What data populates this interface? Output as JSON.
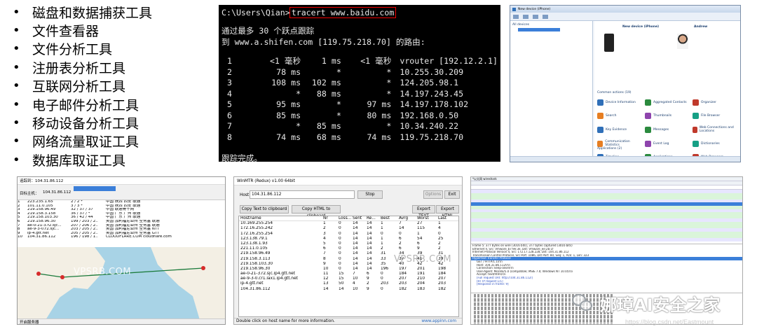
{
  "bullets": [
    "磁盘和数据捕获工具",
    "文件查看器",
    "文件分析工具",
    "注册表分析工具",
    "互联网分析工具",
    "电子邮件分析工具",
    "移动设备分析工具",
    "网络流量取证工具",
    "数据库取证工具"
  ],
  "bullet_glyph": "•",
  "cmd": {
    "prompt": "C:\\Users\\Qian>",
    "command": "tracert www.baidu.com",
    "line1": "通过最多 30 个跃点跟踪",
    "line2": "到 www.a.shifen.com [119.75.218.70] 的路由:",
    "hops": [
      [
        "1",
        "<1 毫秒",
        "1 ms",
        "<1 毫秒",
        "vrouter [192.12.2.1]"
      ],
      [
        "2",
        "78 ms",
        "*",
        "*",
        "10.255.30.209"
      ],
      [
        "3",
        "108 ms",
        "102 ms",
        "*",
        "124.205.98.1"
      ],
      [
        "4",
        "*",
        "88 ms",
        "*",
        "14.197.243.45"
      ],
      [
        "5",
        "95 ms",
        "*",
        "97 ms",
        "14.197.178.102"
      ],
      [
        "6",
        "85 ms",
        "*",
        "80 ms",
        "192.168.0.50"
      ],
      [
        "7",
        "*",
        "85 ms",
        "*",
        "10.34.240.22"
      ],
      [
        "8",
        "74 ms",
        "68 ms",
        "74 ms",
        "119.75.218.70"
      ]
    ],
    "footer": "跟踪完成。"
  },
  "device_explorer": {
    "title": "New device (iPhone)",
    "person": "Andrew",
    "tree_root": "All devices",
    "sections": [
      "Common actions (19)",
      "Applications (2)"
    ],
    "actions": [
      "Device Information",
      "Aggregated Contacts",
      "Organizer",
      "Search",
      "Thumbnails",
      "File Browser",
      "Key Evidence",
      "Messages",
      "Web Connections and Locations",
      "Communication Statistics",
      "Event Log",
      "Dictionaries",
      "Timeline",
      "Applications",
      "Web Browsers"
    ],
    "icon_colors": [
      "#2f6fb8",
      "#2b8a3e",
      "#c0392b",
      "#e67e22",
      "#8e44ad",
      "#16a085"
    ]
  },
  "besttrace": {
    "title": "追踪到：104.31.86.112",
    "host_label": "目标主机：",
    "host": "104.31.86.112",
    "rows": [
      [
        "1",
        "223.235.1.65",
        "2 / 2 *",
        "中国 陕西 西安 联通"
      ],
      [
        "2",
        "101.11.0.105",
        "3 / 3 *",
        "中国 陕西 西安 联通"
      ],
      [
        "3",
        "219.158.96.49",
        "32 / 37 / 37",
        "中国 联通骨干网"
      ],
      [
        "4",
        "219.158.3.158",
        "36 / 37 / *",
        "中国 广东 广州 联通"
      ],
      [
        "5",
        "219.158.103.30",
        "36 / 42 / 44",
        "中国 广东 广州 联通"
      ],
      [
        "6",
        "219.158.96.30",
        "199 / 203 / 2..",
        "美国 加利福尼亚州 圣何塞 联通"
      ],
      [
        "7",
        "ae-0-21-3.r2.sjc...",
        "207 / 206 / 2..",
        "美国 加利福尼亚州 圣何塞 联通"
      ],
      [
        "8",
        "ae-9-3-0.r2.sjc...",
        "203 / 205 / 2..",
        "美国 加利福尼亚州 圣何塞 NTT"
      ],
      [
        "9",
        "ip-4.gtt.net",
        "205 / 205 / 2..",
        "美国 加利福尼亚州 圣何塞 GTT"
      ],
      [
        "10",
        "104.31.86.112",
        "196 / 198 / 1..",
        "CLOUDFLARE.COM cloudflare.com"
      ]
    ],
    "map_watermark": "VPSRB.COM",
    "status": "开启服务器"
  },
  "winmtr": {
    "title": "WinMTR (Redux) v1.00 64bit",
    "host_label": "Host",
    "host": "104.31.86.112",
    "stop": "Stop",
    "options": "Options",
    "exit": "Exit",
    "copy_text": "Copy Text to clipboard",
    "copy_html": "Copy HTML to clipboard",
    "export_text": "Export TEXT",
    "export_html": "Export HTML",
    "headers": [
      "Hostname",
      "Nr",
      "Loss...",
      "Sent",
      "Re...",
      "Best",
      "Avrg",
      "Worst",
      "Last"
    ],
    "rows": [
      [
        "10.169.255.254",
        "1",
        "0",
        "14",
        "14",
        "1",
        "7",
        "27",
        "1"
      ],
      [
        "172.16.255.242",
        "2",
        "0",
        "14",
        "14",
        "1",
        "14",
        "115",
        "4"
      ],
      [
        "172.16.255.254",
        "3",
        "0",
        "14",
        "14",
        "0",
        "0",
        "1",
        "0"
      ],
      [
        "123.138.79.1",
        "4",
        "0",
        "14",
        "14",
        "1",
        "6",
        "54",
        "25"
      ],
      [
        "123.138.1.93",
        "5",
        "0",
        "14",
        "14",
        "1",
        "2",
        "6",
        "2"
      ],
      [
        "221.11.0.105",
        "6",
        "0",
        "14",
        "14",
        "2",
        "6",
        "9",
        "2"
      ],
      [
        "219.158.96.49",
        "7",
        "0",
        "14",
        "14",
        "31",
        "34",
        "39",
        "31"
      ],
      [
        "219.158.3.113",
        "8",
        "0",
        "14",
        "14",
        "33",
        "37",
        "41",
        "39"
      ],
      [
        "219.158.103.30",
        "9",
        "0",
        "14",
        "14",
        "35",
        "40",
        "42",
        "42"
      ],
      [
        "219.158.96.30",
        "10",
        "0",
        "14",
        "14",
        "196",
        "197",
        "201",
        "198"
      ],
      [
        "ae-0-21-3.r2.sjc.ip4.gtt.net",
        "11",
        "15",
        "7",
        "6",
        "0",
        "184",
        "191",
        "184"
      ],
      [
        "ae-9-3-0.cr1.lax1.ip4.gtt.net",
        "12",
        "15",
        "10",
        "9",
        "0",
        "207",
        "210",
        "207"
      ],
      [
        "ip-4.gtt.net",
        "13",
        "50",
        "4",
        "2",
        "203",
        "203",
        "204",
        "203"
      ],
      [
        "104.31.86.112",
        "14",
        "14",
        "10",
        "9",
        "0",
        "182",
        "183",
        "182"
      ]
    ],
    "watermark": "VPSRB.COM",
    "status": "Double click on host name for more information.",
    "status_url": "www.appinn.com"
  },
  "wireshark": {
    "title": "*以太网 wireshark",
    "detail_lines": [
      "Frame 5: 377 bytes on wire (3016 bits), 377 bytes captured (3016 bits)",
      "Ethernet II, Src: Vmware_b7:9e:3e, Dst: Vmware_ee:2b:1f",
      "Internet Protocol Version 4, Src: 172.17.128.228, Dst: 104.31.86.112",
      "Transmission Control Protocol, Src Port: 1086, Dst Port: 80, Seq: 1, Ack: 1, Len: 323",
      "Hypertext Transfer Protocol",
      "GET / HTTP/1.1\\r\\n",
      "Host: 104.31.86.112\\r\\n",
      "Connection: keep-alive\\r\\n",
      "User-Agent: Mozilla/5.0 (compatible; MSIE 7.0; Windows NT 10.0)\\r\\n",
      "Accept: text/html\\r\\n",
      "[Full request URI: http://104.31.86.112/]",
      "[HTTP request 1/1]",
      "[Response in frame: 9]"
    ]
  },
  "brand": {
    "name": "娜璋AI安全之家",
    "blog": "https://blog.csdn.net/Eastmount"
  }
}
